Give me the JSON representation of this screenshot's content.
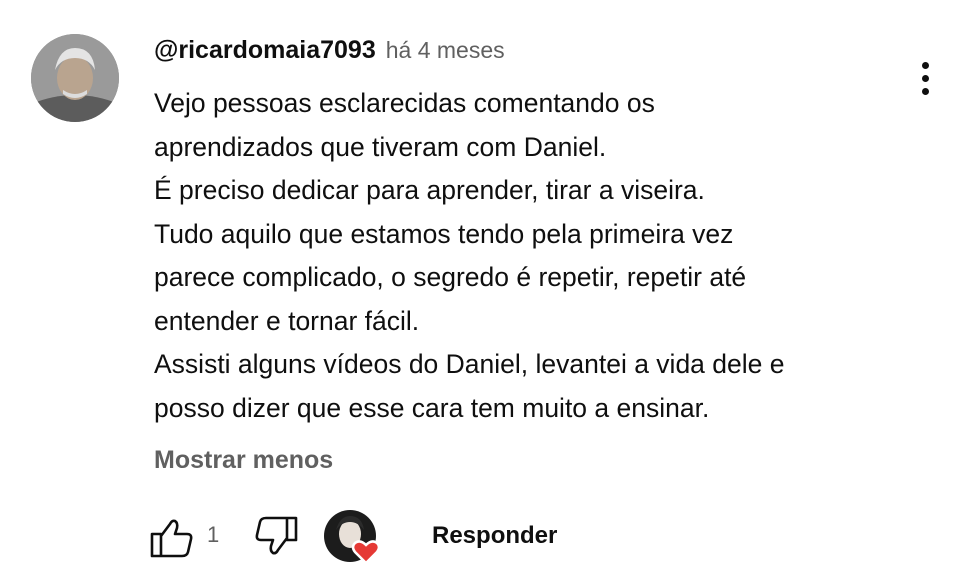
{
  "comment": {
    "author": "@ricardomaia7093",
    "timestamp": "há 4 meses",
    "body_lines": [
      "Vejo pessoas esclarecidas comentando os",
      "aprendizados que tiveram com Daniel.",
      "É preciso dedicar para aprender, tirar a viseira.",
      "Tudo aquilo que estamos tendo pela primeira vez",
      "parece complicado, o segredo é repetir, repetir até",
      "entender e tornar fácil.",
      "Assisti alguns vídeos do Daniel, levantei a vida dele e",
      "posso dizer que esse cara tem muito a ensinar."
    ],
    "show_less_label": "Mostrar menos",
    "like_count": "1",
    "reply_label": "Responder"
  },
  "icons": {
    "menu": "vertical-dots-icon",
    "like": "thumbs-up-icon",
    "dislike": "thumbs-down-icon",
    "creator_heart": "heart-icon"
  },
  "colors": {
    "text_primary": "#0f0f0f",
    "text_secondary": "#606060",
    "heart": "#e53935",
    "background": "#ffffff"
  }
}
